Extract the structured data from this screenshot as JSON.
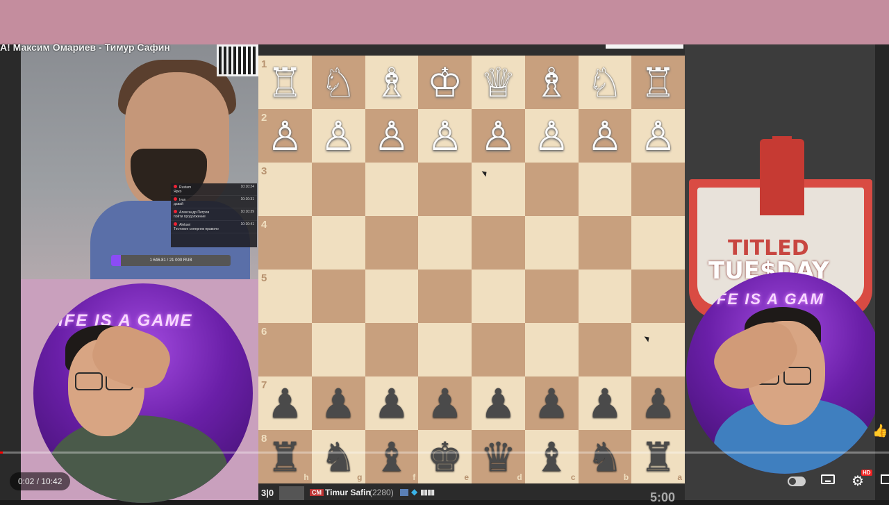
{
  "stream": {
    "title": "А! Максим Омариев - Тимур Сафин"
  },
  "chat": {
    "rows": [
      {
        "user": "Rustam",
        "time": "10:10:24",
        "msg": "Ярко"
      },
      {
        "user": "Ivan",
        "time": "10:10:31",
        "msg": "давай"
      },
      {
        "user": "Александр Петров",
        "time": "10:10:39",
        "msg": "пойти продолжение"
      },
      {
        "user": "Aleksei",
        "time": "10:10:41",
        "msg": "Тестовое соперник правило"
      }
    ]
  },
  "donation": {
    "text": "1 646.81 / 21 000 RUB",
    "progress_fraction": 0.08
  },
  "board": {
    "ranks": [
      "1",
      "2",
      "3",
      "4",
      "5",
      "6",
      "7",
      "8"
    ],
    "files": [
      "h",
      "g",
      "f",
      "e",
      "d",
      "c",
      "b",
      "a"
    ],
    "pieces": [
      [
        "♖",
        "♘",
        "♗",
        "♔",
        "♕",
        "♗",
        "♘",
        "♖"
      ],
      [
        "♙",
        "♙",
        "♙",
        "♙",
        "♙",
        "♙",
        "♙",
        "♙"
      ],
      [
        "",
        "",
        "",
        "",
        "",
        "",
        "",
        ""
      ],
      [
        "",
        "",
        "",
        "",
        "",
        "",
        "",
        ""
      ],
      [
        "",
        "",
        "",
        "",
        "",
        "",
        "",
        ""
      ],
      [
        "",
        "",
        "",
        "",
        "",
        "",
        "",
        ""
      ],
      [
        "♟",
        "♟",
        "♟",
        "♟",
        "♟",
        "♟",
        "♟",
        "♟"
      ],
      [
        "♜",
        "♞",
        "♝",
        "♚",
        "♛",
        "♝",
        "♞",
        "♜"
      ]
    ],
    "light_color": "#f0dfc0",
    "dark_color": "#c8a07e"
  },
  "player_bottom": {
    "time_control": "3|0",
    "title": "CM",
    "name": "Timur Safin",
    "rating": "(2280)",
    "clock": "5:00"
  },
  "event": {
    "line1": "TITLED",
    "line2": "TUE$DAY"
  },
  "overlay": {
    "neon_left": "IFE IS A GAME",
    "neon_right": "FE IS A GAM"
  },
  "player": {
    "time": "0:02 / 10:42",
    "progress_fraction": 0.003,
    "hd_badge": "HD"
  }
}
